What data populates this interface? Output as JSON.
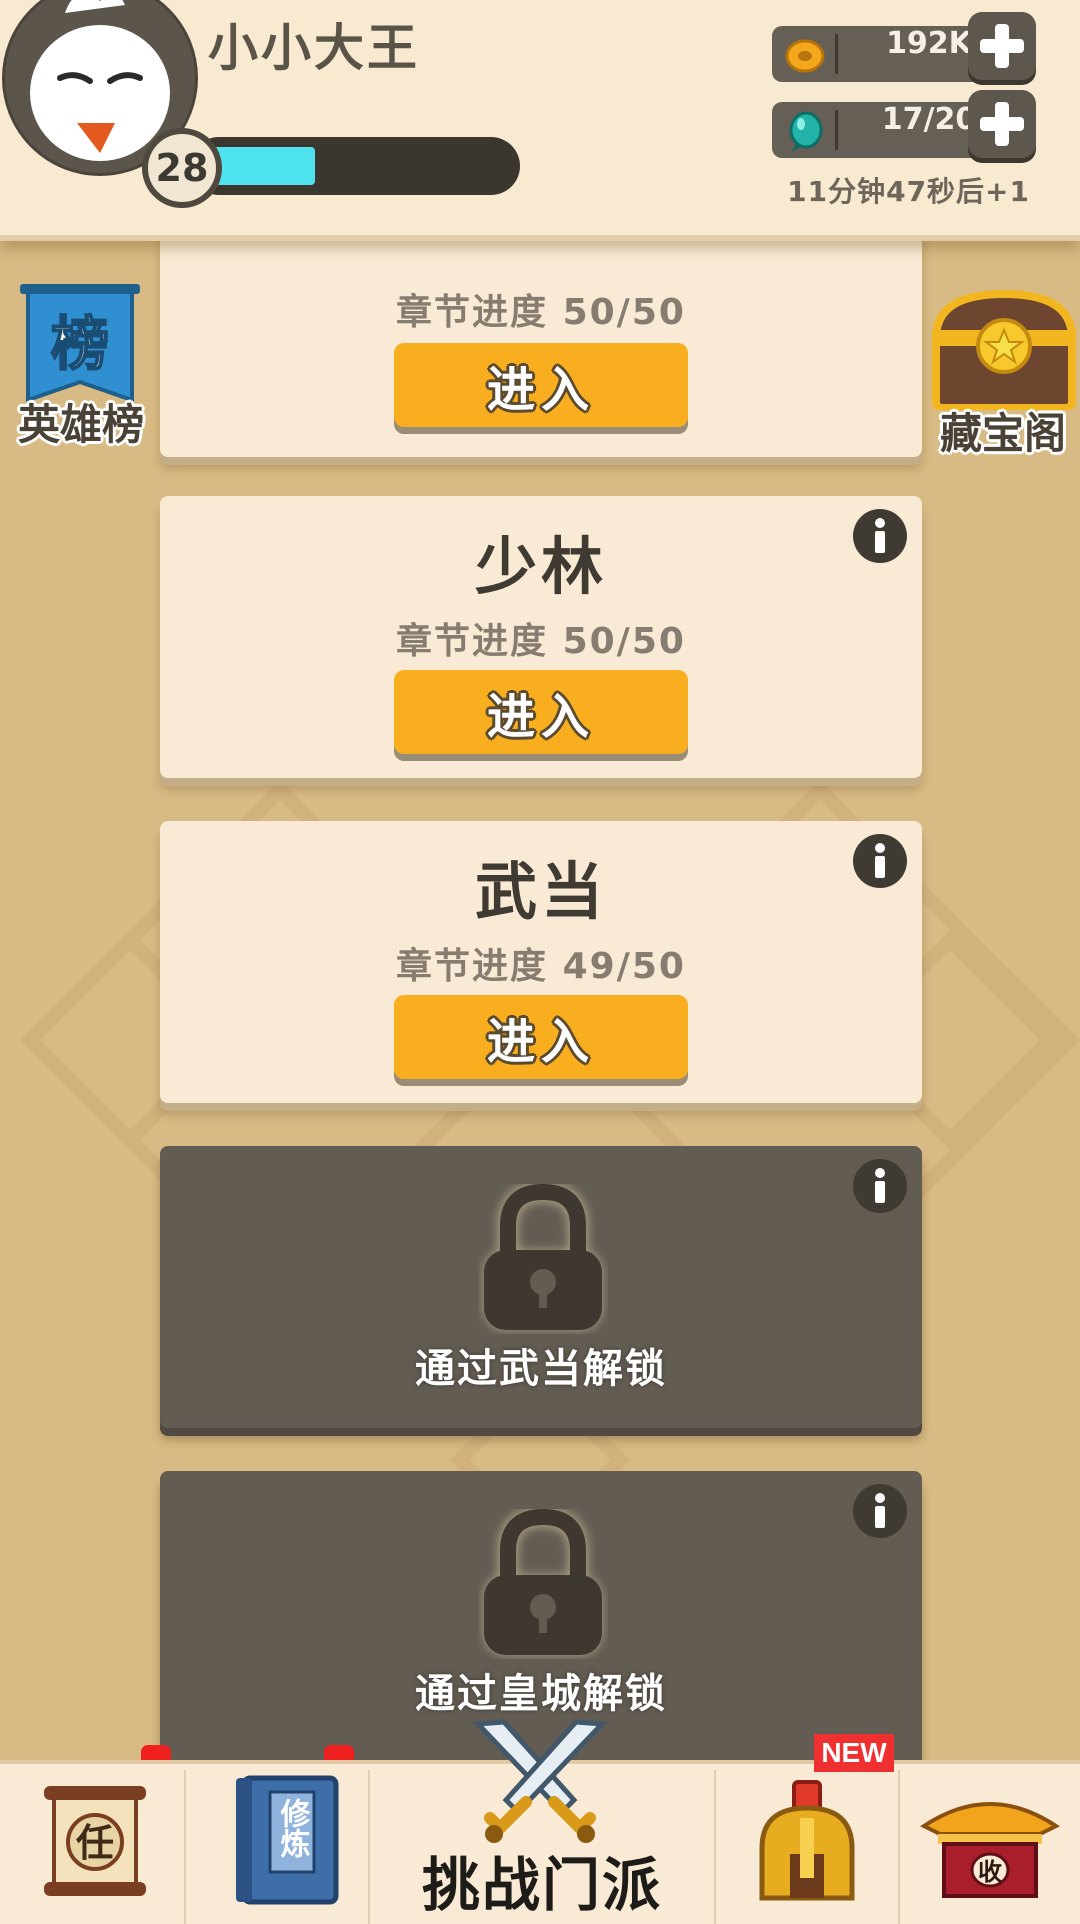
{
  "player": {
    "name": "小小大王",
    "level": "28",
    "xp_fraction": 0.38
  },
  "resources": {
    "coins": "192K",
    "gems": "17/20",
    "regen_timer": "11分钟47秒后+1"
  },
  "side": {
    "leaderboard_badge": "榜",
    "leaderboard_label": "英雄榜",
    "treasure_label": "藏宝阁"
  },
  "stages": [
    {
      "title": "",
      "progress": "章节进度 50/50",
      "enter_label": "进入"
    },
    {
      "title": "少林",
      "progress": "章节进度 50/50",
      "enter_label": "进入"
    },
    {
      "title": "武当",
      "progress": "章节进度 49/50",
      "enter_label": "进入"
    },
    {
      "locked_text": "通过武当解锁"
    },
    {
      "locked_text": "通过皇城解锁"
    }
  ],
  "nav": {
    "task_char": "任",
    "training_chars": "修炼",
    "challenge_label": "挑战门派",
    "new_badge": "NEW",
    "collect_char": "收"
  },
  "colors": {
    "background": "#d8bb84",
    "card": "#f8ead4",
    "locked_card": "#635c53",
    "enter_button": "#f9ae1f",
    "xp_fill": "#4ee3ee"
  }
}
